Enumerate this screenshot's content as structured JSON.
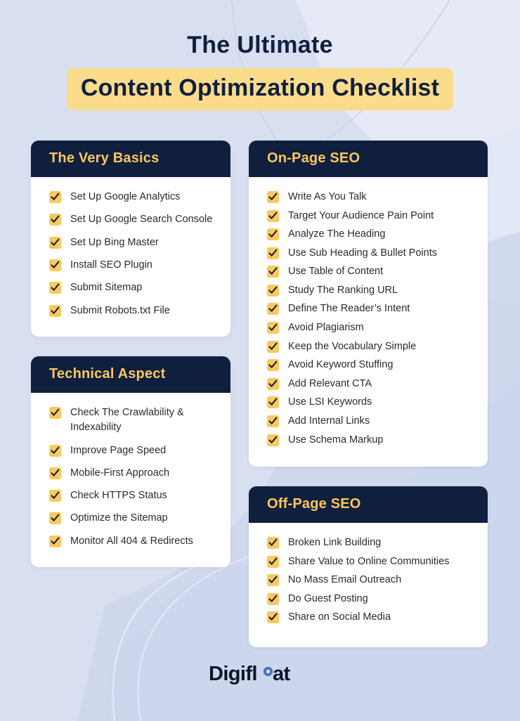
{
  "theme": {
    "background": "#d8dff0",
    "background_light": "#e5eaf6",
    "background_blob": "#ccd6ec",
    "navy": "#101f3e",
    "yellow": "#fbdc8b",
    "header_yellow": "#fbc85a",
    "checkbox_yellow": "#fcc95e",
    "text": "#2b2b30",
    "logo_blue": "#4a72c4"
  },
  "header": {
    "title_line1": "The Ultimate",
    "title_line2": "Content Optimization Checklist"
  },
  "cards": [
    {
      "id": "the-very-basics",
      "title": "The Very Basics",
      "items": [
        "Set Up Google Analytics",
        "Set Up Google Search Console",
        "Set Up Bing Master",
        "Install SEO Plugin",
        "Submit Sitemap",
        "Submit Robots.txt File"
      ]
    },
    {
      "id": "technical-aspect",
      "title": "Technical Aspect",
      "items": [
        "Check The Crawlability & Indexability",
        "Improve Page Speed",
        "Mobile-First Approach",
        "Check HTTPS Status",
        "Optimize the Sitemap",
        "Monitor All 404 & Redirects"
      ]
    },
    {
      "id": "on-page-seo",
      "title": "On-Page SEO",
      "items": [
        "Write As You Talk",
        "Target Your Audience Pain Point",
        "Analyze The Heading",
        "Use Sub Heading & Bullet Points",
        "Use Table of Content",
        "Study The Ranking URL",
        "Define The Reader’s Intent",
        "Avoid Plagiarism",
        "Keep the Vocabulary Simple",
        "Avoid Keyword Stuffing",
        "Add Relevant CTA",
        "Use LSI Keywords",
        "Add Internal Links",
        "Use Schema Markup"
      ]
    },
    {
      "id": "off-page-seo",
      "title": "Off-Page SEO",
      "items": [
        "Broken Link Building",
        "Share Value to Online Communities",
        "No Mass Email Outreach",
        "Do Guest Posting",
        "Share on Social Media"
      ]
    }
  ],
  "footer": {
    "logo_text_before": "Digifl",
    "logo_text_after": "at",
    "logo_full": "Digifloat"
  }
}
